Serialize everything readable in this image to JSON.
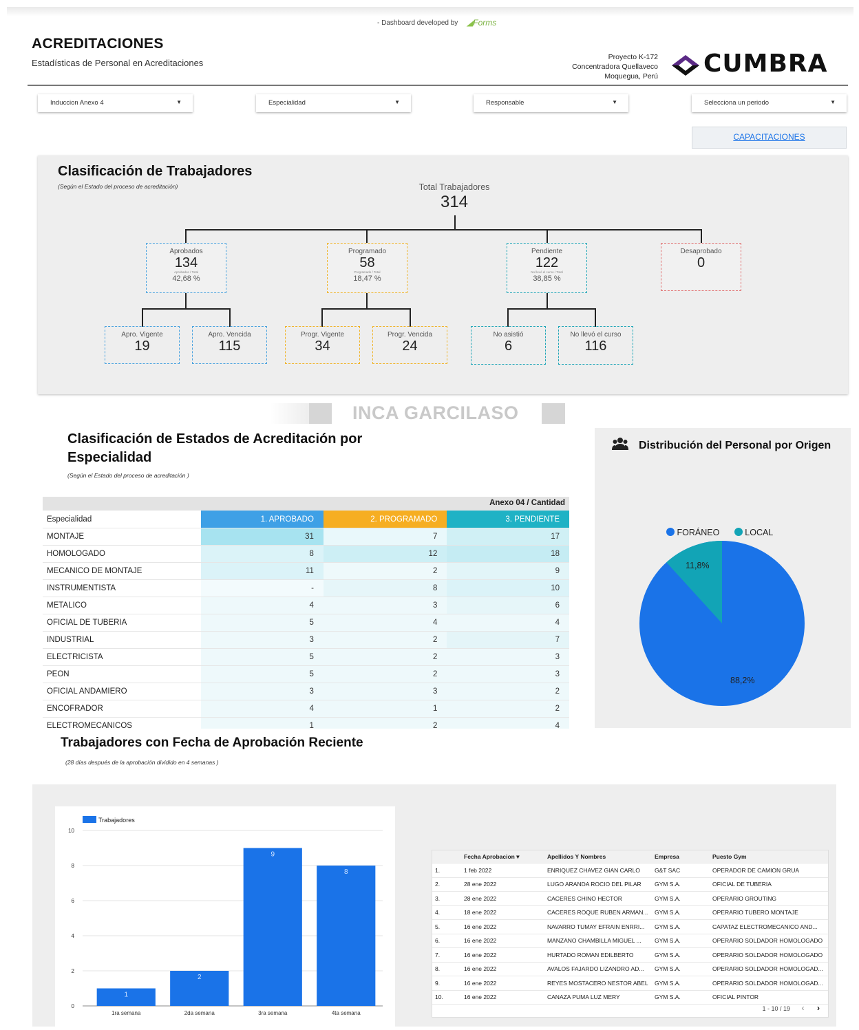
{
  "header": {
    "dev_text": "- Dashboard developed by",
    "dev_logo": "Forms",
    "title": "ACREDITACIONES",
    "subtitle": "Estadísticas de Personal en Acreditaciones",
    "project": [
      "Proyecto K-172",
      "Concentradora Quellaveco",
      "Moquegua, Perú"
    ],
    "brand": "CUMBRA"
  },
  "filters": [
    {
      "label": "Induccion Anexo 4"
    },
    {
      "label": "Especialidad"
    },
    {
      "label": "Responsable"
    },
    {
      "label": "Selecciona un periodo"
    }
  ],
  "cap_button": "CAPACITACIONES",
  "tree": {
    "title": "Clasificación de Trabajadores",
    "note": "(Según el Estado del proceso de acreditación)",
    "total_label": "Total Trabajadores",
    "total": "314",
    "aprobados": {
      "label": "Aprobados",
      "value": "134",
      "small": "Aprobados / Total",
      "pct": "42,68 %"
    },
    "programado": {
      "label": "Programado",
      "value": "58",
      "small": "Programado / Total",
      "pct": "18,47 %"
    },
    "pendiente": {
      "label": "Pendiente",
      "value": "122",
      "small": "No llevó el curso / Total",
      "pct": "38,85 %"
    },
    "desaprobado": {
      "label": "Desaprobado",
      "value": "0"
    },
    "apro_vigente": {
      "label": "Apro. Vigente",
      "value": "19"
    },
    "apro_vencida": {
      "label": "Apro. Vencida",
      "value": "115"
    },
    "progr_vigente": {
      "label": "Progr. Vigente",
      "value": "34"
    },
    "progr_vencida": {
      "label": "Progr. Vencida",
      "value": "24"
    },
    "no_asistio": {
      "label": "No asistió",
      "value": "6"
    },
    "no_llevo": {
      "label": "No llevó el curso",
      "value": "116"
    }
  },
  "watermark": "INCA GARCILASO",
  "specialty": {
    "title": "Clasificación de Estados de Acreditación por Especialidad",
    "note": "(Según el Estado del proceso de acreditación )",
    "group_header": "Anexo 04 / Cantidad",
    "col_especialidad": "Especialidad",
    "columns": [
      "1. APROBADO",
      "2. PROGRAMADO",
      "3. PENDIENTE"
    ],
    "rows": [
      {
        "name": "MONTAJE",
        "a": "31",
        "p": "7",
        "pe": "17"
      },
      {
        "name": "HOMOLOGADO",
        "a": "8",
        "p": "12",
        "pe": "18"
      },
      {
        "name": "MECANICO DE MONTAJE",
        "a": "11",
        "p": "2",
        "pe": "9"
      },
      {
        "name": "INSTRUMENTISTA",
        "a": "-",
        "p": "8",
        "pe": "10"
      },
      {
        "name": "METALICO",
        "a": "4",
        "p": "3",
        "pe": "6"
      },
      {
        "name": "OFICIAL DE TUBERIA",
        "a": "5",
        "p": "4",
        "pe": "4"
      },
      {
        "name": "INDUSTRIAL",
        "a": "3",
        "p": "2",
        "pe": "7"
      },
      {
        "name": "ELECTRICISTA",
        "a": "5",
        "p": "2",
        "pe": "3"
      },
      {
        "name": "PEON",
        "a": "5",
        "p": "2",
        "pe": "3"
      },
      {
        "name": "OFICIAL ANDAMIERO",
        "a": "3",
        "p": "3",
        "pe": "2"
      },
      {
        "name": "ENCOFRADOR",
        "a": "4",
        "p": "1",
        "pe": "2"
      },
      {
        "name": "ELECTROMECANICOS",
        "a": "1",
        "p": "2",
        "pe": "4"
      }
    ]
  },
  "pie": {
    "title": "Distribución del Personal por Origen",
    "icon": "users-icon",
    "legend": [
      {
        "name": "FORÁNEO",
        "color": "#1a73e8"
      },
      {
        "name": "LOCAL",
        "color": "#12a4b6"
      }
    ],
    "labels": {
      "foraneo": "88,2%",
      "local": "11,8%"
    }
  },
  "recent": {
    "title": "Trabajadores con Fecha de Aprobación Reciente",
    "note": "(28 días después de la aprobación dividido en 4 semanas )"
  },
  "chart_data": {
    "type": "bar",
    "categories": [
      "1ra semana",
      "2da semana",
      "3ra semana",
      "4ta semana"
    ],
    "series": [
      {
        "name": "Trabajadores",
        "values": [
          1,
          2,
          9,
          8
        ]
      }
    ],
    "ylim": [
      0,
      10
    ],
    "yticks": [
      "0",
      "2",
      "4",
      "6",
      "8",
      "10"
    ],
    "color": "#1a73e8"
  },
  "workers_table": {
    "headers": [
      "Fecha Aprobacion ▾",
      "Apellidos Y Nombres",
      "Empresa",
      "Puesto Gym"
    ],
    "rows": [
      {
        "n": "1.",
        "fecha": "1 feb 2022",
        "nombre": "ENRIQUEZ CHAVEZ GIAN CARLO",
        "empresa": "G&T SAC",
        "puesto": "OPERADOR DE CAMION GRUA"
      },
      {
        "n": "2.",
        "fecha": "28 ene 2022",
        "nombre": "LUGO ARANDA ROCIO DEL PILAR",
        "empresa": "GYM S.A.",
        "puesto": "OFICIAL DE TUBERIA"
      },
      {
        "n": "3.",
        "fecha": "28 ene 2022",
        "nombre": "CACERES CHINO HECTOR",
        "empresa": "GYM S.A.",
        "puesto": "OPERARIO GROUTING"
      },
      {
        "n": "4.",
        "fecha": "18 ene 2022",
        "nombre": "CACERES ROQUE RUBEN ARMAN...",
        "empresa": "GYM S.A.",
        "puesto": "OPERARIO TUBERO MONTAJE"
      },
      {
        "n": "5.",
        "fecha": "16 ene 2022",
        "nombre": "NAVARRO TUMAY EFRAIN ENRRI...",
        "empresa": "GYM S.A.",
        "puesto": "CAPATAZ ELECTROMECANICO AND..."
      },
      {
        "n": "6.",
        "fecha": "16 ene 2022",
        "nombre": "MANZANO CHAMBILLA MIGUEL ...",
        "empresa": "GYM S.A.",
        "puesto": "OPERARIO SOLDADOR HOMOLOGADO"
      },
      {
        "n": "7.",
        "fecha": "16 ene 2022",
        "nombre": "HURTADO ROMAN EDILBERTO",
        "empresa": "GYM S.A.",
        "puesto": "OPERARIO SOLDADOR HOMOLOGADO"
      },
      {
        "n": "8.",
        "fecha": "16 ene 2022",
        "nombre": "AVALOS FAJARDO LIZANDRO AD...",
        "empresa": "GYM S.A.",
        "puesto": "OPERARIO SOLDADOR HOMOLOGAD..."
      },
      {
        "n": "9.",
        "fecha": "16 ene 2022",
        "nombre": "REYES MOSTACERO NESTOR ABEL",
        "empresa": "GYM S.A.",
        "puesto": "OPERARIO SOLDADOR HOMOLOGAD..."
      },
      {
        "n": "10.",
        "fecha": "16 ene 2022",
        "nombre": "CANAZA PUMA LUZ MERY",
        "empresa": "GYM S.A.",
        "puesto": "OFICIAL PINTOR"
      }
    ],
    "pagination": "1 - 10 / 19"
  }
}
